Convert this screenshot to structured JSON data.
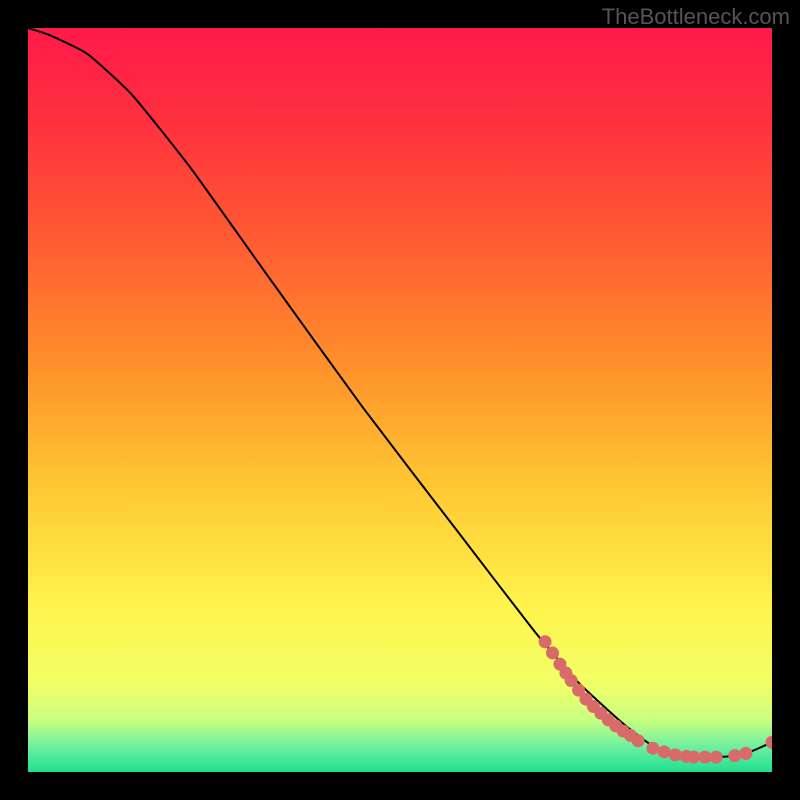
{
  "watermark": "TheBottleneck.com",
  "chart_data": {
    "type": "line",
    "title": "",
    "xlabel": "",
    "ylabel": "",
    "xlim": [
      0,
      100
    ],
    "ylim": [
      0,
      100
    ],
    "gradient_stops": [
      {
        "offset": 0.0,
        "color": "#ff1a4a"
      },
      {
        "offset": 0.12,
        "color": "#ff2f3f"
      },
      {
        "offset": 0.28,
        "color": "#ff5a33"
      },
      {
        "offset": 0.45,
        "color": "#ff8f2a"
      },
      {
        "offset": 0.62,
        "color": "#ffc933"
      },
      {
        "offset": 0.78,
        "color": "#fff44d"
      },
      {
        "offset": 0.88,
        "color": "#f2ff66"
      },
      {
        "offset": 0.93,
        "color": "#c8ff80"
      },
      {
        "offset": 0.965,
        "color": "#70f0a0"
      },
      {
        "offset": 1.0,
        "color": "#1fe090"
      }
    ],
    "curve": [
      {
        "x": 0,
        "y": 100
      },
      {
        "x": 3,
        "y": 99
      },
      {
        "x": 8,
        "y": 96.5
      },
      {
        "x": 14,
        "y": 91
      },
      {
        "x": 22,
        "y": 81
      },
      {
        "x": 32,
        "y": 67
      },
      {
        "x": 45,
        "y": 49
      },
      {
        "x": 58,
        "y": 32
      },
      {
        "x": 68,
        "y": 19
      },
      {
        "x": 74,
        "y": 12
      },
      {
        "x": 80,
        "y": 6.5
      },
      {
        "x": 84,
        "y": 3.5
      },
      {
        "x": 88,
        "y": 2.2
      },
      {
        "x": 92,
        "y": 2.0
      },
      {
        "x": 96,
        "y": 2.3
      },
      {
        "x": 100,
        "y": 4.0
      }
    ],
    "scatter": [
      {
        "x": 69.5,
        "y": 17.5
      },
      {
        "x": 70.5,
        "y": 16.0
      },
      {
        "x": 71.5,
        "y": 14.5
      },
      {
        "x": 72.3,
        "y": 13.3
      },
      {
        "x": 73.0,
        "y": 12.3
      },
      {
        "x": 74.0,
        "y": 11.0
      },
      {
        "x": 75.0,
        "y": 9.8
      },
      {
        "x": 76.0,
        "y": 8.8
      },
      {
        "x": 77.0,
        "y": 7.9
      },
      {
        "x": 78.0,
        "y": 7.0
      },
      {
        "x": 79.0,
        "y": 6.2
      },
      {
        "x": 80.0,
        "y": 5.5
      },
      {
        "x": 81.0,
        "y": 4.9
      },
      {
        "x": 82.0,
        "y": 4.2
      },
      {
        "x": 84.0,
        "y": 3.2
      },
      {
        "x": 85.5,
        "y": 2.7
      },
      {
        "x": 87.0,
        "y": 2.3
      },
      {
        "x": 88.5,
        "y": 2.1
      },
      {
        "x": 89.5,
        "y": 2.0
      },
      {
        "x": 91.0,
        "y": 2.0
      },
      {
        "x": 92.5,
        "y": 2.0
      },
      {
        "x": 95.0,
        "y": 2.2
      },
      {
        "x": 96.5,
        "y": 2.5
      },
      {
        "x": 100.0,
        "y": 4.0
      }
    ],
    "scatter_color": "#d86a6a",
    "curve_color": "#000000"
  }
}
